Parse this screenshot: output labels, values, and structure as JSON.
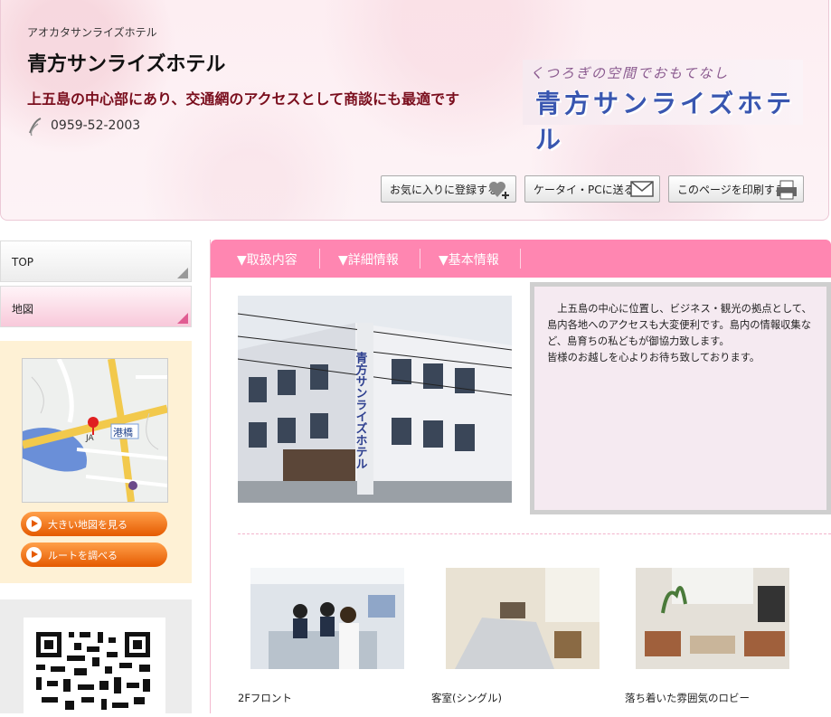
{
  "header": {
    "kana": "アオカタサンライズホテル",
    "name": "青方サンライズホテル",
    "tagline": "上五島の中心部にあり、交通網のアクセスとして商談にも最適です",
    "phone": "0959-52-2003",
    "logo_sub": "くつろぎの空間でおもてなし",
    "logo_main": "青方サンライズホテル",
    "buttons": {
      "favorite": "お気に入りに登録する",
      "send": "ケータイ・PCに送る",
      "print": "このページを印刷する"
    }
  },
  "sidebar": {
    "nav": [
      {
        "label": "TOP"
      },
      {
        "label": "地図"
      }
    ],
    "map_labels": {
      "port": "港橋",
      "ja": "JA"
    },
    "map_buttons": {
      "big_map": "大きい地図を見る",
      "route": "ルートを調べる"
    }
  },
  "main": {
    "tabs": [
      {
        "label": "▼取扱内容"
      },
      {
        "label": "▼詳細情報"
      },
      {
        "label": "▼基本情報"
      }
    ],
    "description": [
      "　上五島の中心に位置し、ビジネス・観光の拠点として、島内各地へのアクセスも大変便利です。島内の情報収集など、島育ちの私どもが御協力致します。",
      "皆様のお越しを心よりお待ち致しております。"
    ],
    "photo_sign": "青方サンライズホテル",
    "gallery": [
      {
        "caption": "2Fフロント"
      },
      {
        "caption": "客室(シングル)"
      },
      {
        "caption": "落ち着いた雰囲気のロビー"
      }
    ]
  },
  "colors": {
    "tab_pink": "#ff86b1",
    "tagline": "#7a0e1d",
    "map_button": "#e55a00"
  }
}
